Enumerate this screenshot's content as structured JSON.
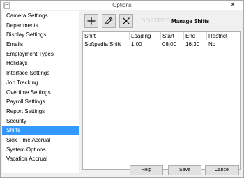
{
  "window": {
    "title": "Options",
    "close_glyph": "✕"
  },
  "sidebar": {
    "items": [
      {
        "label": "Camera Settings"
      },
      {
        "label": "Departments"
      },
      {
        "label": "Display Settings"
      },
      {
        "label": "Emails"
      },
      {
        "label": "Employment Types"
      },
      {
        "label": "Holidays"
      },
      {
        "label": "Interface Settings"
      },
      {
        "label": "Job Tracking"
      },
      {
        "label": "Overtime Settings"
      },
      {
        "label": "Payroll Settings"
      },
      {
        "label": "Report Settings"
      },
      {
        "label": "Security"
      },
      {
        "label": "Shifts",
        "selected": true
      },
      {
        "label": "Sick Time Accrual"
      },
      {
        "label": "System Options"
      },
      {
        "label": "Vacation Accrual"
      }
    ],
    "selected_color": "#3399ff"
  },
  "toolbar": {
    "add_icon": "plus-icon",
    "edit_icon": "pencil-icon",
    "delete_icon": "x-icon",
    "heading": "Manage Shifts",
    "watermark": "SOFTPEDIA"
  },
  "table": {
    "columns": [
      "Shift",
      "Loading",
      "Start",
      "End",
      "Restrict"
    ],
    "rows": [
      {
        "shift": "Softpedia Shift",
        "loading": "1.00",
        "start": "08:00",
        "end": "16:30",
        "restrict": "No"
      }
    ]
  },
  "buttons": {
    "help_first": "H",
    "help_rest": "elp",
    "save_first": "S",
    "save_rest": "ave",
    "cancel_first": "C",
    "cancel_rest": "ancel"
  }
}
